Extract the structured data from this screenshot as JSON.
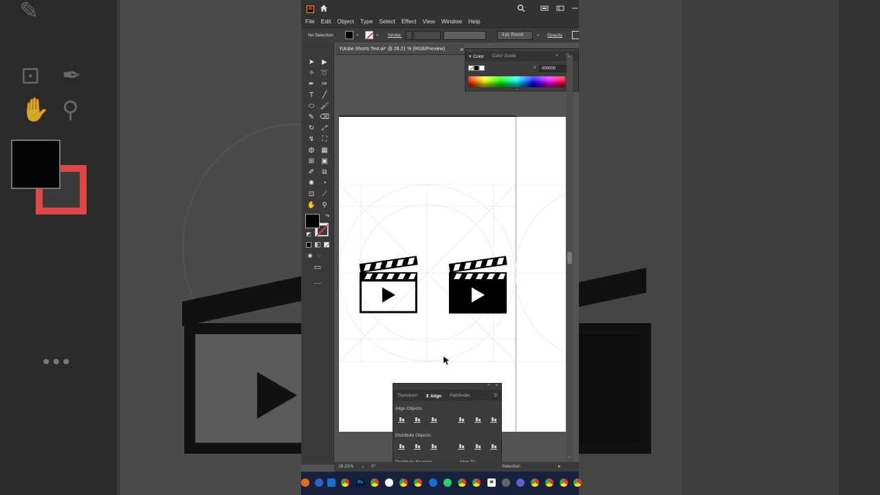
{
  "app": {
    "logo": "Ai",
    "brand_color": "#ff9a00"
  },
  "menu": [
    "File",
    "Edit",
    "Object",
    "Type",
    "Select",
    "Effect",
    "View",
    "Window",
    "Help"
  ],
  "control_bar": {
    "selection": "No Selection",
    "stroke_label": "Stroke:",
    "stroke_style": "3 pt. Round",
    "opacity_label": "Opacity"
  },
  "document": {
    "tab_title": "Yutube Shorts Test.ai* @ 28.21 % (RGB/Preview)",
    "close_glyph": "×"
  },
  "color_panel": {
    "tabs": [
      "Color",
      "Color Guide"
    ],
    "hex_prefix": "#",
    "hex_value": "000000"
  },
  "align_panel": {
    "tabs": [
      "Transform",
      "Align",
      "Pathfinder"
    ],
    "align_objects_label": "Align Objects:",
    "distribute_objects_label": "Distribute Objects:",
    "distribute_spacing_label": "Distribute Spacing:",
    "align_to_label": "Align To:"
  },
  "status": {
    "zoom": "28.21%",
    "rotation": "0°",
    "tool": "Selection"
  },
  "colors": {
    "fill": "#000000",
    "stroke_none": "#e43b3b",
    "artboard": "#ffffff",
    "ui_dark": "#323232"
  },
  "taskbar_icons": [
    "ps-icon",
    "file-icon",
    "chrome-icon",
    "edge-icon",
    "mail-icon",
    "whatsapp-icon",
    "settings-icon"
  ]
}
